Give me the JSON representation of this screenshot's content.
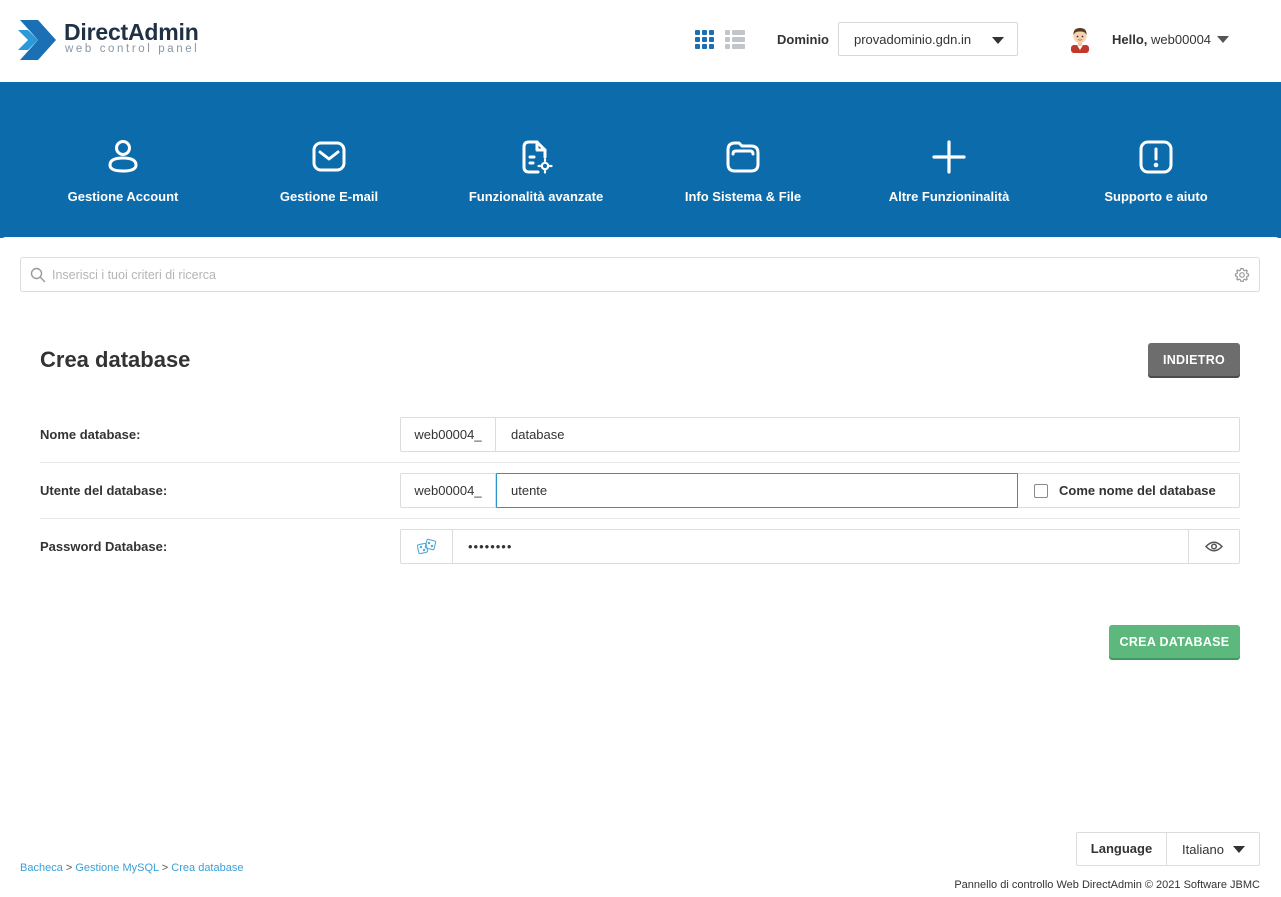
{
  "header": {
    "logo_title": "DirectAdmin",
    "logo_subtitle": "web control panel",
    "domain_label": "Dominio",
    "domain_value": "provadominio.gdn.in",
    "hello_prefix": "Hello,",
    "username": "web00004"
  },
  "nav": {
    "items": [
      {
        "label": "Gestione Account",
        "icon": "user-icon"
      },
      {
        "label": "Gestione E-mail",
        "icon": "envelope-icon"
      },
      {
        "label": "Funzionalità avanzate",
        "icon": "file-gear-icon"
      },
      {
        "label": "Info Sistema & File",
        "icon": "folder-icon"
      },
      {
        "label": "Altre Funzioninalità",
        "icon": "plus-icon"
      },
      {
        "label": "Supporto e aiuto",
        "icon": "alert-icon"
      }
    ]
  },
  "search": {
    "placeholder": "Inserisci i tuoi criteri di ricerca"
  },
  "page": {
    "title": "Crea database",
    "back_button": "INDIETRO",
    "create_button": "CREA DATABASE"
  },
  "form": {
    "db_name_label": "Nome database:",
    "db_name_prefix": "web00004_",
    "db_name_value": "database",
    "db_user_label": "Utente del database:",
    "db_user_prefix": "web00004_",
    "db_user_value": "utente",
    "same_as_db_label": "Come nome del database",
    "password_label": "Password Database:",
    "password_value": "••••••••"
  },
  "footer": {
    "language_label": "Language",
    "language_value": "Italiano",
    "breadcrumb": [
      "Bacheca",
      "Gestione MySQL",
      "Crea database"
    ],
    "breadcrumb_sep": ">",
    "copyright": "Pannello di controllo Web DirectAdmin © 2021 Software JBMC"
  },
  "colors": {
    "nav_bg": "#0c6bab",
    "accent_blue": "#1a6fb5",
    "create_green": "#5cb87c",
    "back_gray": "#6d6d6d",
    "link_blue": "#3aa0d8"
  }
}
